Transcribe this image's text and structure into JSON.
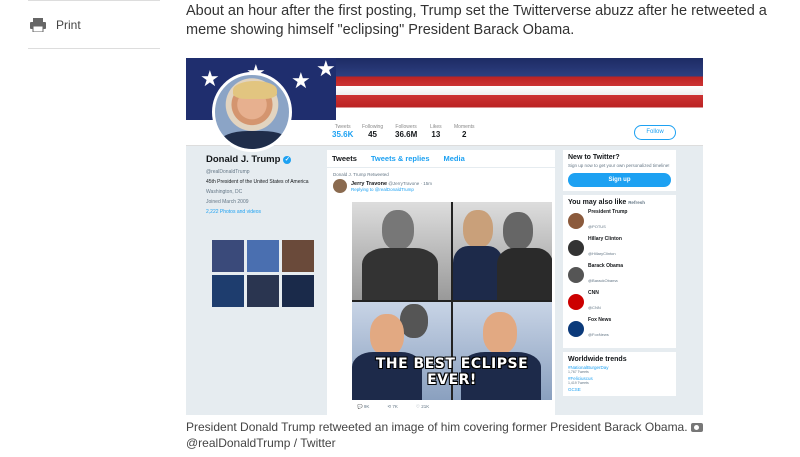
{
  "sidebar": {
    "print_label": "Print"
  },
  "article": {
    "paragraph": "About an hour after the first posting, Trump set the Twitterverse abuzz after he retweeted a meme showing himself \"eclipsing\" President Barack Obama.",
    "caption": "President Donald Trump retweeted an image of him covering former President Barack Obama.",
    "credit": "@realDonaldTrump / Twitter"
  },
  "embed": {
    "stats": [
      {
        "label": "Tweets",
        "value": "35.6K"
      },
      {
        "label": "Following",
        "value": "45"
      },
      {
        "label": "Followers",
        "value": "36.6M"
      },
      {
        "label": "Likes",
        "value": "13"
      },
      {
        "label": "Moments",
        "value": "2"
      }
    ],
    "follow_label": "Follow",
    "profile": {
      "name": "Donald J. Trump",
      "handle": "@realDonaldTrump",
      "bio": "45th President of the United States of America",
      "location": "Washington, DC",
      "joined": "Joined March 2009",
      "photos": "2,222 Photos and videos"
    },
    "tabs": [
      "Tweets",
      "Tweets & replies",
      "Media"
    ],
    "tweet": {
      "retweeted_by": "Donald J. Trump Retweeted",
      "author": "Jerry Travone",
      "author_handle": "@JerryTravone · 15m",
      "replying": "Replying to @realDonaldTrump",
      "meme_text": "THE BEST ECLIPSE EVER!",
      "replies": "9K",
      "retweets": "7K",
      "likes": "21K"
    },
    "new_to_twitter": {
      "title": "New to Twitter?",
      "sub": "Sign up now to get your own personalized timeline!",
      "button": "Sign up"
    },
    "you_may_like": {
      "title": "You may also like",
      "refresh": "Refresh",
      "accounts": [
        {
          "name": "President Trump",
          "handle": "@POTUS"
        },
        {
          "name": "Hillary Clinton",
          "handle": "@HillaryClinton"
        },
        {
          "name": "Barack Obama",
          "handle": "@BarackObama"
        },
        {
          "name": "CNN",
          "handle": "@CNN"
        },
        {
          "name": "Fox News",
          "handle": "@FoxNews"
        }
      ]
    },
    "trends": {
      "title": "Worldwide trends",
      "items": [
        {
          "tag": "#NationalBurgerDay",
          "count": "1,767 Tweets"
        },
        {
          "tag": "#Feliciuscus",
          "count": "1,419 Tweets"
        },
        {
          "tag": "GCSE",
          "count": ""
        }
      ]
    }
  }
}
